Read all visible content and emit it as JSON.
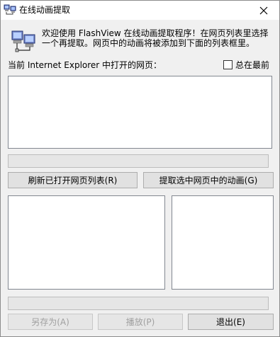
{
  "window": {
    "title": "在线动画提取",
    "icon": "network-computers-icon",
    "close_glyph": "✕"
  },
  "intro": {
    "icon": "network-computers-icon",
    "text": "欢迎使用 FlashView 在线动画提取程序！在网页列表里选择一个再提取。网页中的动画将被添加到下面的列表框里。"
  },
  "pages_label": "当前 Internet Explorer 中打开的网页：",
  "always_on_top": {
    "label": "总在最前",
    "checked": false
  },
  "progress_top": {
    "value": 0
  },
  "progress_bottom": {
    "value": 0
  },
  "buttons": {
    "refresh": "刷新已打开网页列表(R)",
    "extract": "提取选中网页中的动画(G)",
    "save_as": "另存为(A)",
    "play": "播放(P)",
    "exit": "退出(E)"
  },
  "colors": {
    "window_bg": "#f0f0f0",
    "button_bg": "#e1e1e1",
    "disabled_text": "#a0a0a0"
  }
}
